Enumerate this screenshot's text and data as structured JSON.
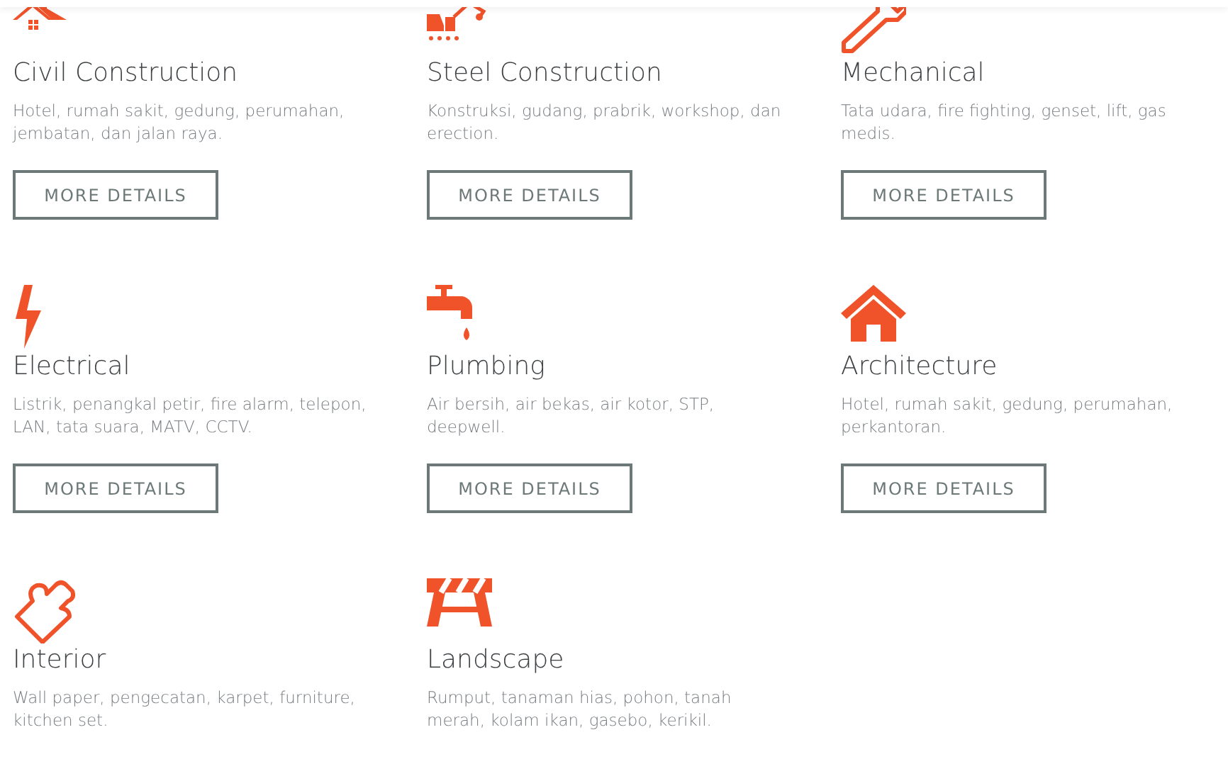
{
  "services": [
    {
      "title": "Civil Construction",
      "description": "Hotel, rumah sakit, gedung, perumahan, jembatan, dan jalan raya.",
      "button": "MORE DETAILS"
    },
    {
      "title": "Steel Construction",
      "description": "Konstruksi, gudang, prabrik, workshop, dan erection.",
      "button": "MORE DETAILS"
    },
    {
      "title": "Mechanical",
      "description": "Tata udara, fire fighting, genset, lift, gas medis.",
      "button": "MORE DETAILS"
    },
    {
      "title": "Electrical",
      "description": "Listrik, penangkal petir, fire alarm, telepon, LAN, tata suara, MATV, CCTV.",
      "button": "MORE DETAILS"
    },
    {
      "title": "Plumbing",
      "description": "Air bersih, air bekas, air kotor, STP, deepwell.",
      "button": "MORE DETAILS"
    },
    {
      "title": "Architecture",
      "description": "Hotel, rumah sakit, gedung, perumahan, perkantoran.",
      "button": "MORE DETAILS"
    },
    {
      "title": "Interior",
      "description": "Wall paper, pengecatan, karpet, furniture, kitchen set."
    },
    {
      "title": "Landscape",
      "description": "Rumput, tanaman hias, pohon, tanah merah, kolam ikan, gasebo, kerikil."
    }
  ]
}
